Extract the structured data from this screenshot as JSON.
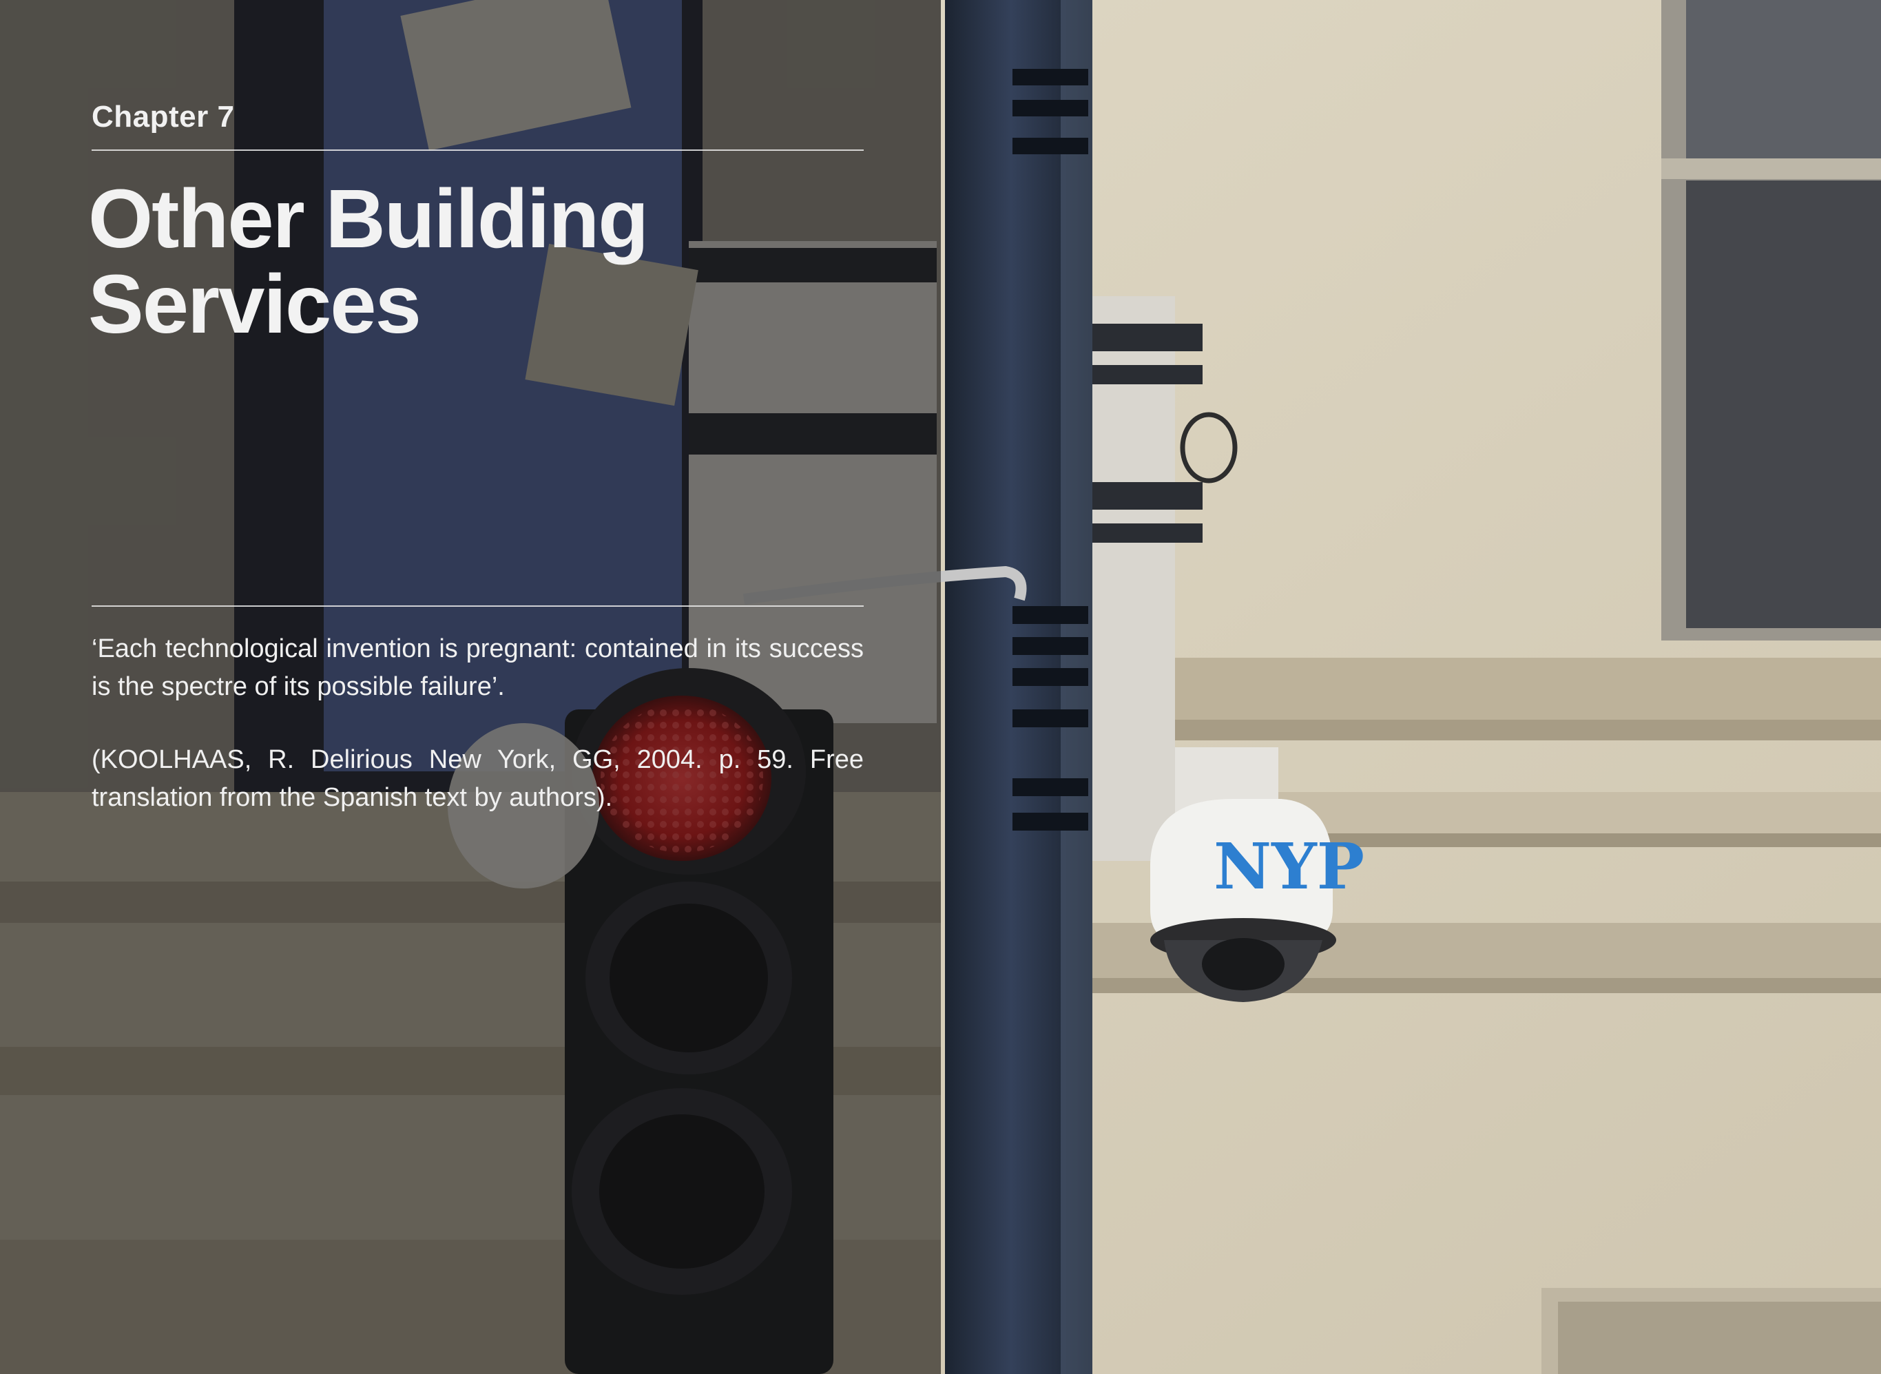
{
  "chapter": {
    "label": "Chapter 7",
    "title_line1": "Other Building",
    "title_line2": "Services"
  },
  "epigraph": {
    "quote": "‘Each technological invention is pregnant: contained in its success is the spectre of its possible failure’.",
    "citation": "(KOOLHAAS, R. Delirious New York, GG, 2004. p. 59. Free translation from the Spanish text by authors)."
  },
  "photo": {
    "description_icon": "street-camera-photo",
    "camera_dome_text": "NYP",
    "colors": {
      "building": "#d8d0bc",
      "pole": "#2a3444",
      "signal_red": "#d11a1a",
      "dome_text": "#2d7fd0"
    }
  }
}
